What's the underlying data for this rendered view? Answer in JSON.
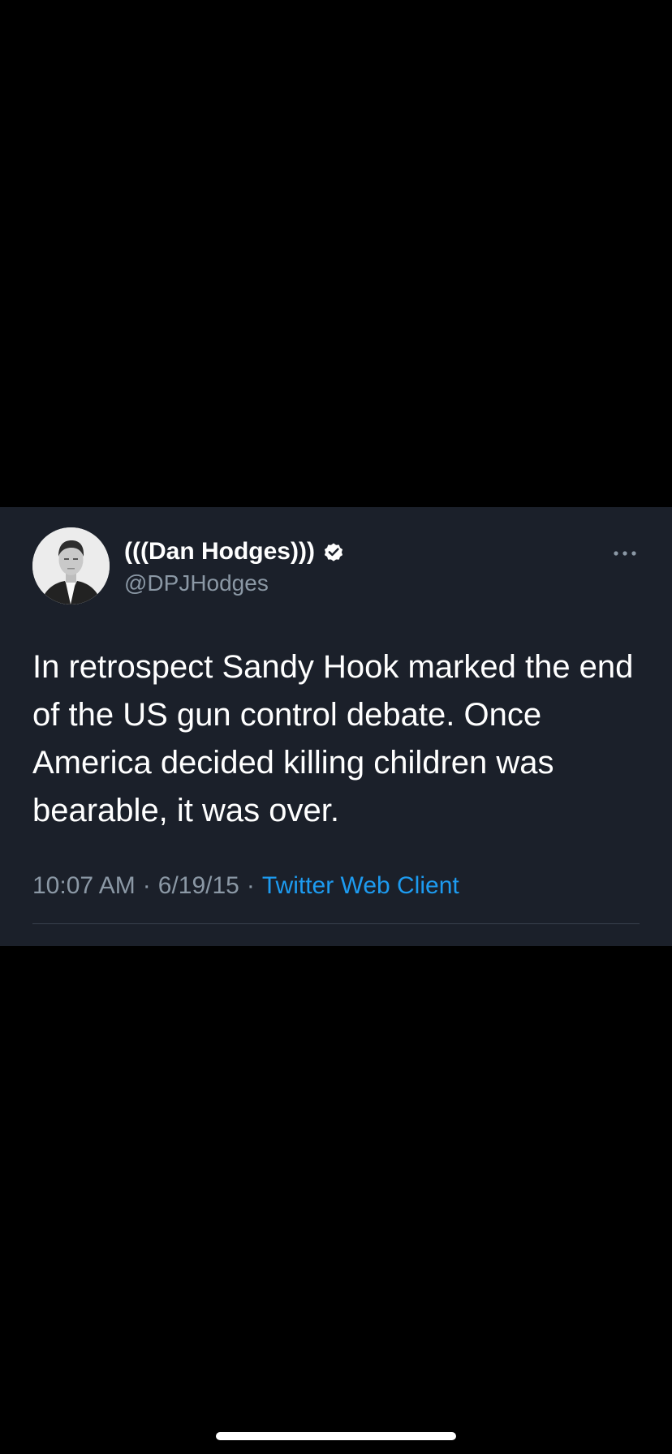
{
  "tweet": {
    "author": {
      "display_name": "(((Dan Hodges)))",
      "handle": "@DPJHodges",
      "verified": true,
      "avatar_icon": "profile-photo"
    },
    "text": "In retrospect Sandy Hook marked the end of the US gun control debate. Once America decided killing children was bearable, it was over.",
    "time": "10:07 AM",
    "date": "6/19/15",
    "separator": "·",
    "source": "Twitter Web Client",
    "more_icon": "more-horizontal-icon"
  },
  "colors": {
    "page_background": "#000000",
    "card_background": "#1b202a",
    "primary_text": "#ffffff",
    "secondary_text": "#8b98a5",
    "link": "#1d9bf0",
    "divider": "#38414d"
  }
}
